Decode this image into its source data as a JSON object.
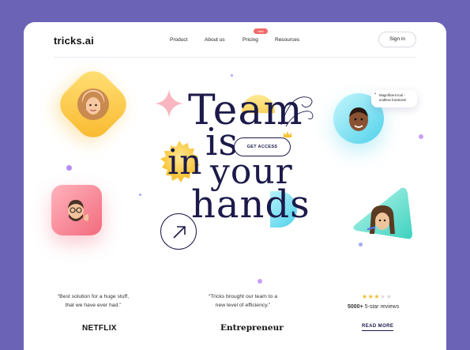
{
  "header": {
    "logo": "tricks.ai",
    "nav": [
      {
        "label": "Product"
      },
      {
        "label": "About us"
      },
      {
        "label": "Pricing",
        "badge": "new"
      },
      {
        "label": "Resources"
      }
    ],
    "signin_label": "Sign in"
  },
  "hero": {
    "line1": "Team",
    "line2_a": "is",
    "line2_b": "in",
    "line3": "your",
    "line4": "hands",
    "cta_label": "GET ACCESS",
    "speech_bubble": "Magnificent tool - endless functions!",
    "speech_quote_mark": "“"
  },
  "testimonials": [
    {
      "open": "“",
      "text_line1": "Best solution for a huge stuff,",
      "text_line2": "that we have ever had.",
      "close": "”",
      "brand": "NETFLIX"
    },
    {
      "open": "“",
      "text_line1": "Tricks brought our team to a",
      "text_line2": "new level of efficiency.",
      "close": "”",
      "brand": "Entrepreneur"
    }
  ],
  "rating": {
    "stars_filled": 3,
    "stars_total": 5,
    "count": "5000+",
    "label": "5-star reviews",
    "read_more": "READ MORE"
  },
  "colors": {
    "background": "#6a63b6",
    "text_dark": "#1b1a4a",
    "badge": "#f26b6b",
    "yellow": "#fcd34d",
    "cyan": "#6ee0f2",
    "pink": "#f8a5b1",
    "star": "#f5b929"
  }
}
